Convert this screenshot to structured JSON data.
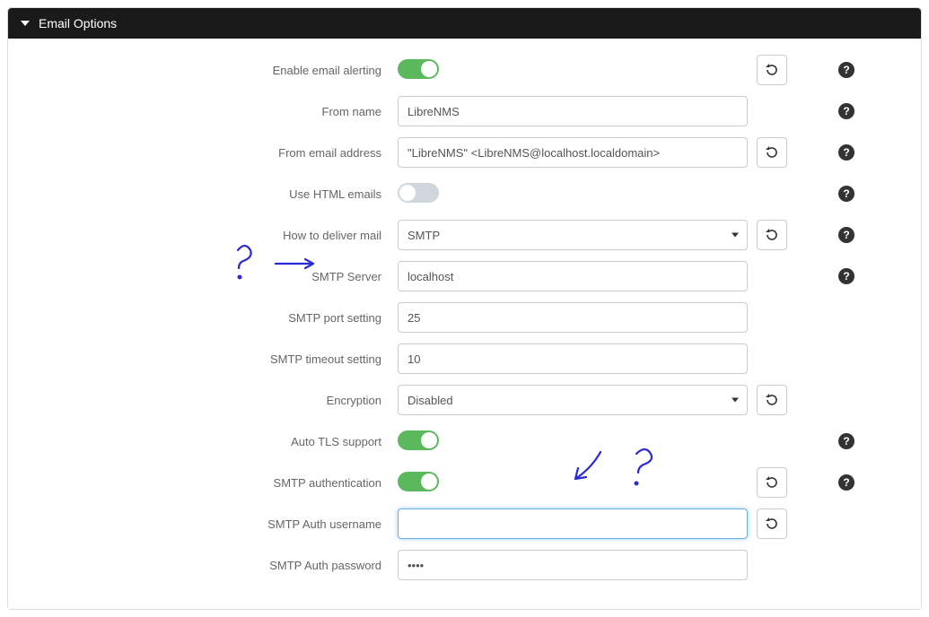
{
  "panel": {
    "title": "Email Options"
  },
  "rows": {
    "enable_alerting": {
      "label": "Enable email alerting",
      "value": true
    },
    "from_name": {
      "label": "From name",
      "value": "LibreNMS"
    },
    "from_email": {
      "label": "From email address",
      "value": "\"LibreNMS\" <LibreNMS@localhost.localdomain>"
    },
    "use_html": {
      "label": "Use HTML emails",
      "value": false
    },
    "deliver": {
      "label": "How to deliver mail",
      "value": "SMTP"
    },
    "smtp_server": {
      "label": "SMTP Server",
      "value": "localhost"
    },
    "smtp_port": {
      "label": "SMTP port setting",
      "value": "25"
    },
    "smtp_timeout": {
      "label": "SMTP timeout setting",
      "value": "10"
    },
    "encryption": {
      "label": "Encryption",
      "value": "Disabled"
    },
    "auto_tls": {
      "label": "Auto TLS support",
      "value": true
    },
    "smtp_auth": {
      "label": "SMTP authentication",
      "value": true
    },
    "auth_user": {
      "label": "SMTP Auth username",
      "value": ""
    },
    "auth_pass": {
      "label": "SMTP Auth password",
      "value": "••••"
    }
  }
}
